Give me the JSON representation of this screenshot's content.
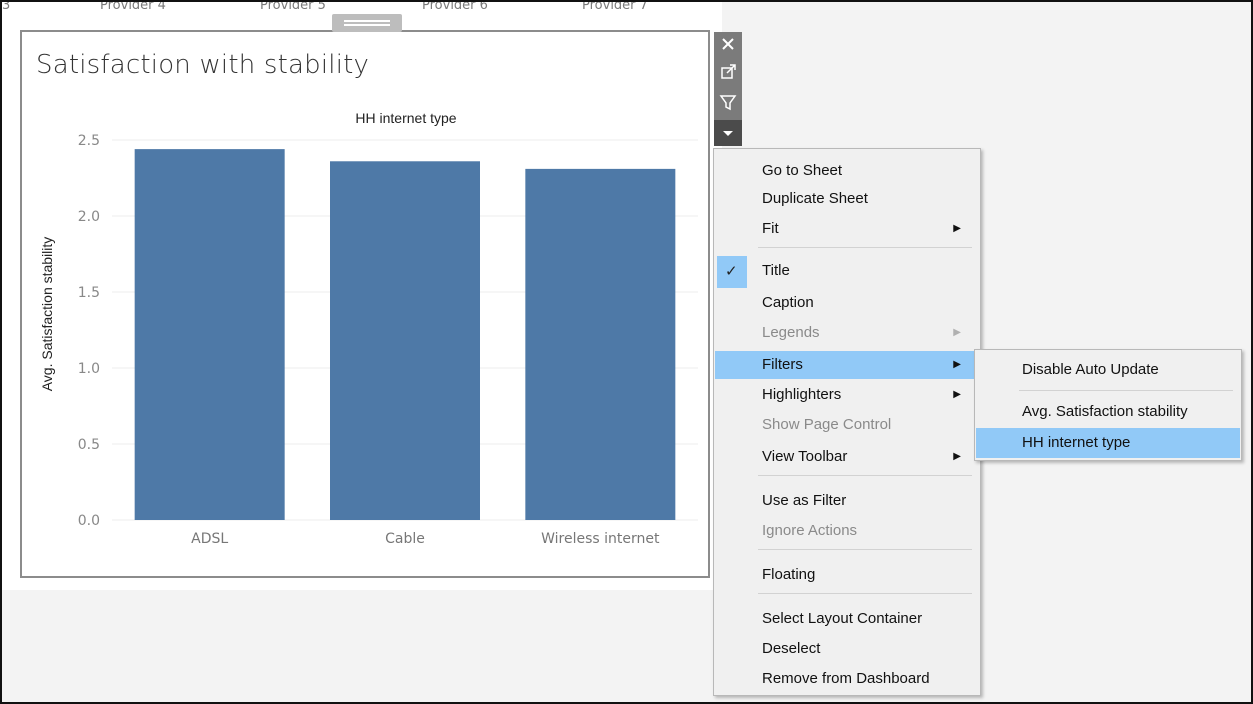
{
  "top_strip": {
    "labels": [
      "3",
      "Provider 4",
      "Provider 5",
      "Provider 6",
      "Provider 7"
    ]
  },
  "sheet": {
    "title": "Satisfaction with stability"
  },
  "toolbar": {
    "close_icon": "close-icon",
    "popout_icon": "popout-icon",
    "filter_icon": "filter-icon",
    "more_icon": "dropdown-arrow-icon"
  },
  "chart_data": {
    "type": "bar",
    "title": "HH internet type",
    "xlabel": "",
    "ylabel": "Avg. Satisfaction stability",
    "categories": [
      "ADSL",
      "Cable",
      "Wireless internet"
    ],
    "values": [
      2.44,
      2.36,
      2.31
    ],
    "ylim": [
      0,
      2.5
    ],
    "yticks": [
      "0.0",
      "0.5",
      "1.0",
      "1.5",
      "2.0",
      "2.5"
    ],
    "bar_color": "#4e79a7",
    "grid": true
  },
  "context_menu": {
    "items": [
      {
        "label": "Go to Sheet"
      },
      {
        "label": "Duplicate Sheet"
      },
      {
        "label": "Fit",
        "submenu": true
      },
      {
        "label": "Title",
        "checked": true
      },
      {
        "label": "Caption"
      },
      {
        "label": "Legends",
        "submenu": true,
        "disabled": true
      },
      {
        "label": "Filters",
        "submenu": true,
        "highlighted": true
      },
      {
        "label": "Highlighters",
        "submenu": true
      },
      {
        "label": "Show Page Control",
        "disabled": true
      },
      {
        "label": "View Toolbar",
        "submenu": true
      },
      {
        "label": "Use as Filter"
      },
      {
        "label": "Ignore Actions",
        "disabled": true
      },
      {
        "label": "Floating"
      },
      {
        "label": "Select Layout Container"
      },
      {
        "label": "Deselect"
      },
      {
        "label": "Remove from Dashboard"
      }
    ],
    "check_mark": "✓"
  },
  "filters_submenu": {
    "items": [
      {
        "label": "Disable Auto Update"
      },
      {
        "label": "Avg. Satisfaction stability"
      },
      {
        "label": "HH internet type",
        "highlighted": true
      }
    ]
  },
  "colors": {
    "menu_highlight": "#91c9f7",
    "toolbar": "#7b7b7b",
    "bar": "#4e79a7"
  }
}
